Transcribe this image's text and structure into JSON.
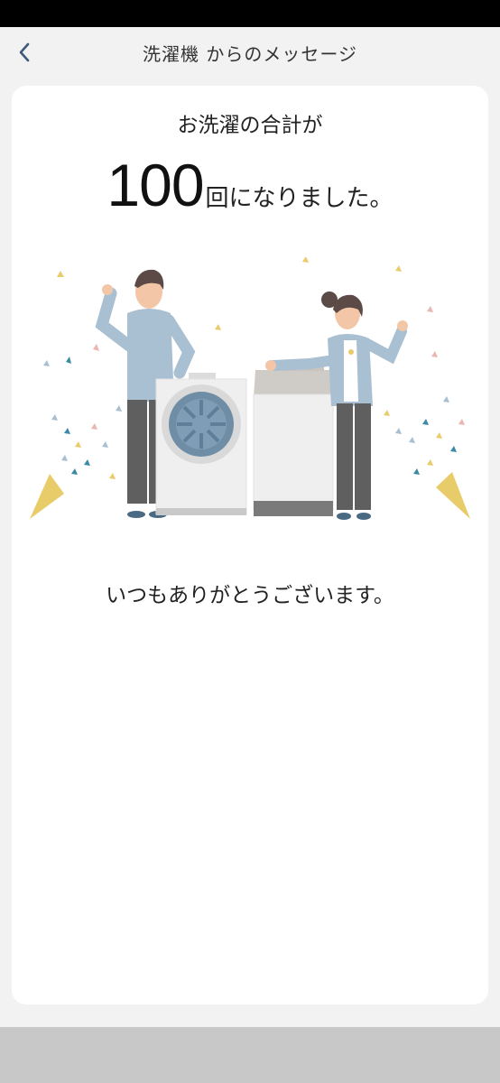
{
  "header": {
    "title": "洗濯機 からのメッセージ",
    "back_icon": "chevron-left-icon"
  },
  "message": {
    "headline": "お洗濯の合計が",
    "count": "100",
    "count_suffix": "回になりました。",
    "thanks": "いつもありがとうございます。"
  },
  "illustration": {
    "description_icon": "celebration-washing-machines-illustration",
    "colors": {
      "shirt": "#a9bfd2",
      "pants": "#5f5f5f",
      "skin": "#f2c6a6",
      "hair": "#5b4a45",
      "machine": "#efefef",
      "drum": "#6f8ea6",
      "party_cone": "#e9cc6a"
    }
  }
}
